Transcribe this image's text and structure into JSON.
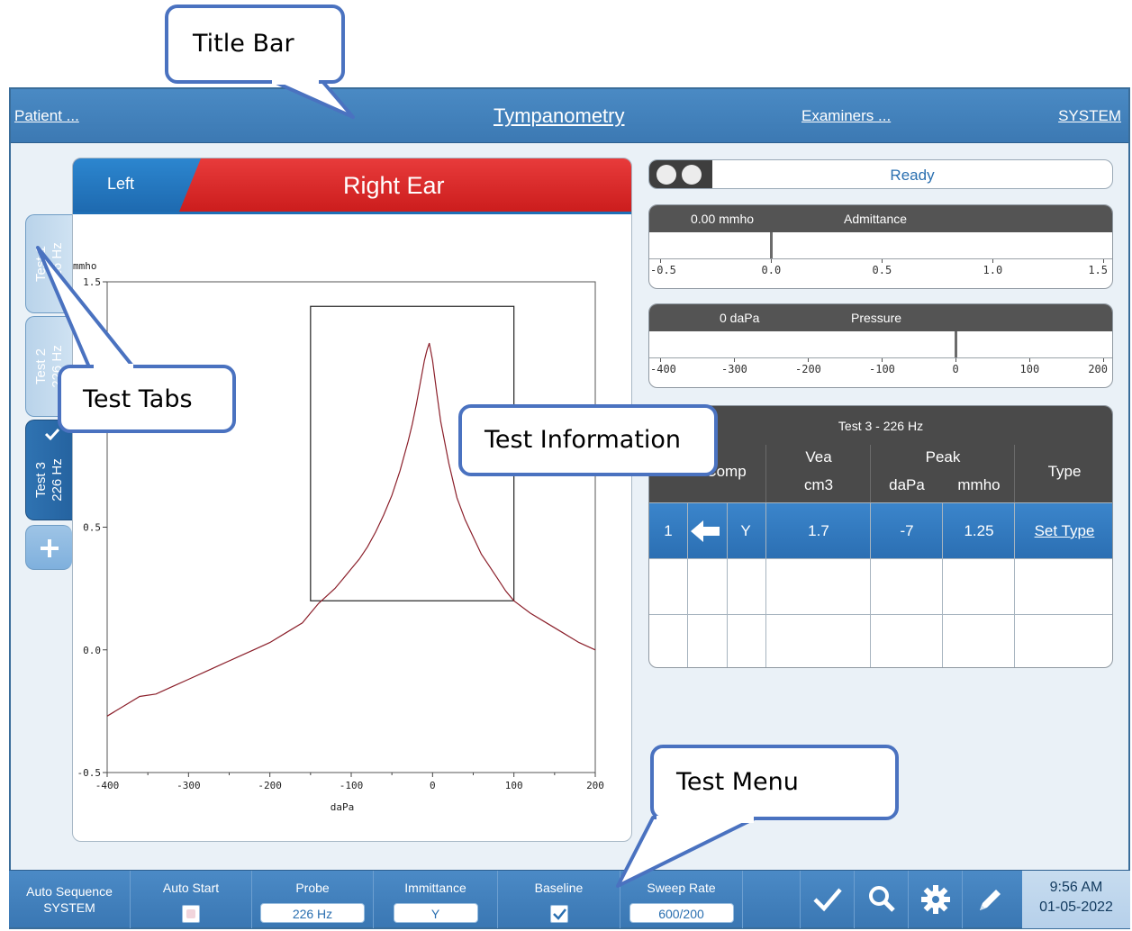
{
  "title_bar": {
    "patient_link": "Patient ...",
    "module_title": "Tympanometry",
    "examiners_link": "Examiners ...",
    "system_link": "SYSTEM"
  },
  "ear": {
    "left_tab": "Left",
    "current": "Right Ear",
    "colors": {
      "right": "#d62a2a",
      "left": "#2176bf"
    }
  },
  "test_tabs": [
    {
      "line1": "Test 1",
      "line2": "226 Hz",
      "active": false
    },
    {
      "line1": "Test 2",
      "line2": "226 Hz",
      "active": false
    },
    {
      "line1": "Test 3",
      "line2": "226 Hz",
      "active": true,
      "checked": true
    }
  ],
  "add_tab_icon": "plus-icon",
  "chart_data": {
    "type": "line",
    "ylabel": "mmho",
    "xlabel": "daPa",
    "xlim": [
      -400,
      200
    ],
    "ylim": [
      -0.5,
      1.5
    ],
    "x_ticks": [
      "-400",
      "-300",
      "-200",
      "-100",
      "0",
      "100",
      "200"
    ],
    "y_ticks": [
      "1.5",
      "0.5",
      "0.0",
      "-0.5"
    ],
    "normal_box": {
      "x": [
        -150,
        100
      ],
      "y": [
        0.2,
        1.4
      ]
    },
    "series": [
      {
        "color": "#8b1f2a",
        "x": [
          -400,
          -380,
          -360,
          -340,
          -320,
          -300,
          -280,
          -260,
          -240,
          -220,
          -200,
          -180,
          -160,
          -150,
          -140,
          -130,
          -120,
          -110,
          -100,
          -90,
          -80,
          -70,
          -60,
          -50,
          -40,
          -30,
          -25,
          -20,
          -15,
          -10,
          -7,
          -4,
          0,
          5,
          10,
          20,
          30,
          40,
          50,
          60,
          70,
          80,
          90,
          100,
          120,
          140,
          160,
          180,
          200
        ],
        "values": [
          -0.27,
          -0.23,
          -0.19,
          -0.18,
          -0.15,
          -0.12,
          -0.09,
          -0.06,
          -0.03,
          0.0,
          0.03,
          0.07,
          0.11,
          0.15,
          0.19,
          0.22,
          0.25,
          0.29,
          0.33,
          0.37,
          0.42,
          0.48,
          0.55,
          0.63,
          0.73,
          0.85,
          0.92,
          1.0,
          1.09,
          1.18,
          1.22,
          1.25,
          1.18,
          1.05,
          0.93,
          0.76,
          0.62,
          0.53,
          0.46,
          0.39,
          0.34,
          0.29,
          0.24,
          0.2,
          0.15,
          0.11,
          0.07,
          0.03,
          0.0
        ]
      }
    ]
  },
  "status": {
    "text": "Ready"
  },
  "admittance": {
    "value": "0.00 mmho",
    "label": "Admittance",
    "scale": [
      "-0.5",
      "0.0",
      "0.5",
      "1.0",
      "1.5"
    ],
    "range": [
      -0.5,
      1.5
    ],
    "reading": 0.0
  },
  "pressure": {
    "value": "0 daPa",
    "label": "Pressure",
    "scale": [
      "-400",
      "-300",
      "-200",
      "-100",
      "0",
      "100",
      "200"
    ],
    "range": [
      -400,
      200
    ],
    "reading": 0
  },
  "results": {
    "caption": "Test 3 - 226 Hz",
    "headers": {
      "comp": "Comp",
      "vea": "Vea",
      "vea_unit": "cm3",
      "peak": "Peak",
      "peak_dapa": "daPa",
      "peak_mmho": "mmho",
      "type": "Type"
    },
    "rows": [
      {
        "num": "1",
        "arrow": "left-arrow-icon",
        "comp": "Y",
        "vea": "1.7",
        "dapa": "-7",
        "mmho": "1.25",
        "type": "Set Type"
      }
    ]
  },
  "callouts": {
    "title_bar": "Title Bar",
    "test_tabs": "Test Tabs",
    "test_information": "Test Information",
    "test_menu": "Test Menu"
  },
  "menu": {
    "auto_sequence_line1": "Auto Sequence",
    "auto_sequence_line2": "SYSTEM",
    "auto_start": "Auto Start",
    "auto_start_checked": false,
    "probe": "Probe",
    "probe_value": "226 Hz",
    "immittance": "Immittance",
    "immittance_value": "Y",
    "baseline": "Baseline",
    "baseline_checked": true,
    "sweep_rate": "Sweep Rate",
    "sweep_rate_value": "600/200",
    "icons": [
      "check-icon",
      "search-icon",
      "gear-icon",
      "pencil-icon"
    ],
    "time": "9:56 AM",
    "date": "01-05-2022"
  }
}
